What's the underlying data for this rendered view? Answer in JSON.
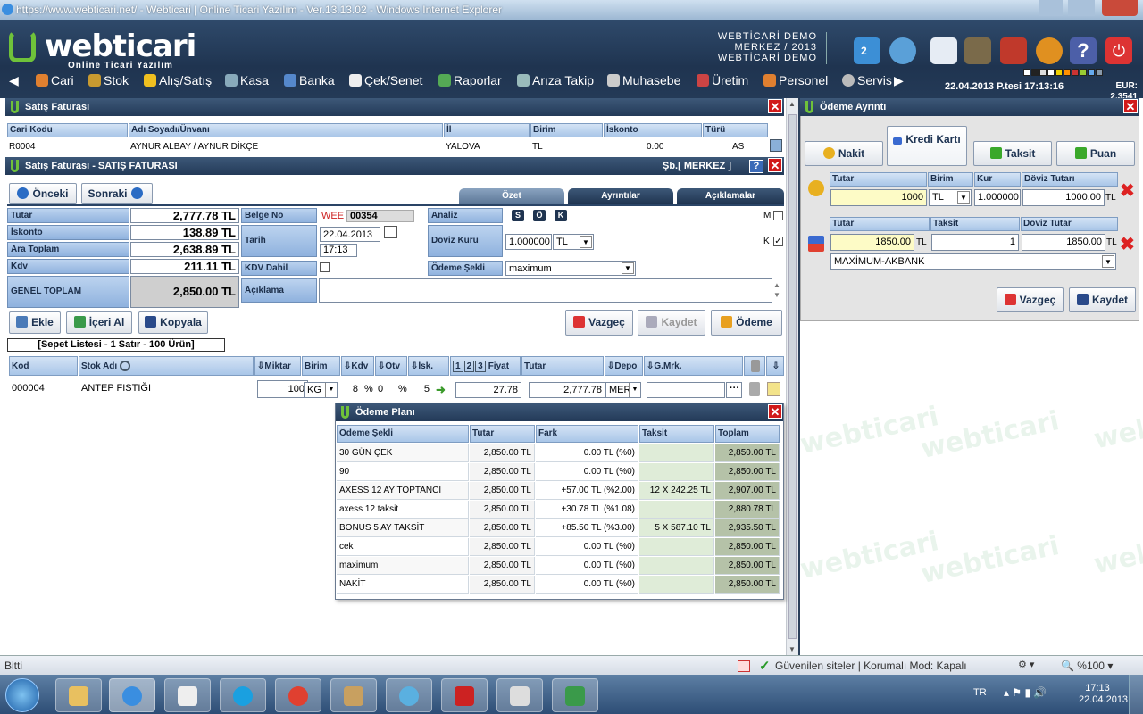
{
  "window": {
    "title": "https://www.webticari.net/ - Webticari | Online Ticari Yazılım - Ver.13.13.02 - Windows Internet Explorer"
  },
  "header": {
    "logo": "webticari",
    "logo_sub": "Online Ticari Yazılım",
    "company_line1": "WEBTİCARİ DEMO",
    "company_line2": "MERKEZ / 2013",
    "company_line3": "WEBTİCARİ DEMO",
    "badge_count": "2",
    "datetime": "22.04.2013 P.tesi 17:13:16",
    "eur_label": "EUR:",
    "eur_value": "2.3541",
    "swatches": [
      "#ffffff",
      "#222222",
      "#dddddd",
      "#ffffff",
      "#f0d000",
      "#ff9000",
      "#cc3333",
      "#99cc33",
      "#66aaee",
      "#8899aa"
    ]
  },
  "menu": {
    "items": [
      "Cari",
      "Stok",
      "Alış/Satış",
      "Kasa",
      "Banka",
      "Çek/Senet",
      "Raporlar",
      "Arıza Takip",
      "Muhasebe",
      "Üretim",
      "Personel",
      "Servis"
    ]
  },
  "invoice_head": {
    "title": "Satış Faturası",
    "columns": [
      "Cari Kodu",
      "Adı Soyadı/Ünvanı",
      "İl",
      "Birim",
      "İskonto",
      "Türü"
    ],
    "row": [
      "R0004",
      "AYNUR ALBAY / AYNUR DİKÇE",
      "YALOVA",
      "TL",
      "0.00",
      "AS"
    ]
  },
  "invoice": {
    "title": "Satış Faturası - SATIŞ FATURASI",
    "branch": "Şb.[ MERKEZ ]",
    "prev": "Önceki",
    "next": "Sonraki",
    "tabs": [
      "Özet",
      "Ayrıntılar",
      "Açıklamalar"
    ],
    "totals": [
      {
        "label": "Tutar",
        "value": "2,777.78 TL"
      },
      {
        "label": "İskonto",
        "value": "138.89 TL"
      },
      {
        "label": "Ara Toplam",
        "value": "2,638.89 TL"
      },
      {
        "label": "Kdv",
        "value": "211.11 TL"
      }
    ],
    "grand_label": "GENEL TOPLAM",
    "grand_value": "2,850.00 TL",
    "belge_label": "Belge No",
    "belge_prefix": "WEE",
    "belge_no": "00354",
    "tarih_label": "Tarih",
    "tarih": "22.04.2013",
    "saat": "17:13",
    "kdv_dahil_label": "KDV Dahil",
    "aciklama_label": "Açıklama",
    "analiz_label": "Analiz",
    "analiz_btns": [
      "S",
      "Ö",
      "K"
    ],
    "doviz_label": "Döviz Kuru",
    "doviz_value": "1.000000",
    "doviz_currency": "TL",
    "odeme_label": "Ödeme Şekli",
    "odeme_value": "maximum",
    "m_label": "M",
    "k_label": "K",
    "buttons": {
      "ekle": "Ekle",
      "iceri_al": "İçeri Al",
      "kopyala": "Kopyala",
      "vazgec": "Vazgeç",
      "kaydet": "Kaydet",
      "odeme": "Ödeme"
    },
    "basket_label": "[Sepet Listesi - 1 Satır - 100 Ürün]",
    "grid_cols": [
      "Kod",
      "Stok Adı",
      "Miktar",
      "Birim",
      "Kdv",
      "Ötv",
      "İsk.",
      "1",
      "2",
      "3",
      "Fiyat",
      "Tutar",
      "Depo",
      "G.Mrk."
    ],
    "grid_row": {
      "kod": "000004",
      "stok": "ANTEP FISTIĞI",
      "miktar": "100",
      "birim": "KG",
      "kdv": "8",
      "kdv_pct": "%",
      "otv": "0",
      "otv_pct": "%",
      "isk": "5",
      "fiyat": "27.78",
      "tutar": "2,777.78",
      "depo": "MER"
    }
  },
  "payment_plan": {
    "title": "Ödeme Planı",
    "columns": [
      "Ödeme Şekli",
      "Tutar",
      "Fark",
      "Taksit",
      "Toplam"
    ],
    "rows": [
      [
        "30 GÜN ÇEK",
        "2,850.00 TL",
        "0.00 TL (%0)",
        "",
        "2,850.00 TL"
      ],
      [
        "90",
        "2,850.00 TL",
        "0.00 TL (%0)",
        "",
        "2,850.00 TL"
      ],
      [
        "AXESS 12 AY TOPTANCI",
        "2,850.00 TL",
        "+57.00 TL (%2.00)",
        "12 X 242.25 TL",
        "2,907.00 TL"
      ],
      [
        "axess 12 taksit",
        "2,850.00 TL",
        "+30.78 TL (%1.08)",
        "",
        "2,880.78 TL"
      ],
      [
        "BONUS 5 AY TAKSİT",
        "2,850.00 TL",
        "+85.50 TL (%3.00)",
        "5 X 587.10 TL",
        "2,935.50 TL"
      ],
      [
        "cek",
        "2,850.00 TL",
        "0.00 TL (%0)",
        "",
        "2,850.00 TL"
      ],
      [
        "maximum",
        "2,850.00 TL",
        "0.00 TL (%0)",
        "",
        "2,850.00 TL"
      ],
      [
        "NAKİT",
        "2,850.00 TL",
        "0.00 TL (%0)",
        "",
        "2,850.00 TL"
      ]
    ]
  },
  "payment_detail": {
    "title": "Ödeme Ayrıntı",
    "tabs": [
      "Nakit",
      "Kredi Kartı",
      "Taksit",
      "Puan"
    ],
    "cash_cols": [
      "Tutar",
      "Birim",
      "Kur",
      "Döviz Tutarı"
    ],
    "cash_tutar": "1000",
    "cash_birim": "TL",
    "cash_kur": "1.000000",
    "cash_doviz": "1000.00",
    "cash_doviz_unit": "TL",
    "card_cols": [
      "Tutar",
      "Taksit",
      "Döviz Tutar"
    ],
    "card_tutar": "1850.00",
    "card_tutar_unit": "TL",
    "card_taksit": "1",
    "card_doviz": "1850.00",
    "card_doviz_unit": "TL",
    "card_bank": "MAXİMUM-AKBANK",
    "vazgec": "Vazgeç",
    "kaydet": "Kaydet",
    "watermark": "webticari"
  },
  "status": {
    "left": "Bitti",
    "zone": "Güvenilen siteler | Korumalı Mod: Kapalı",
    "zoom": "%100"
  },
  "taskbar": {
    "lang": "TR",
    "time": "17:13",
    "date": "22.04.2013"
  }
}
